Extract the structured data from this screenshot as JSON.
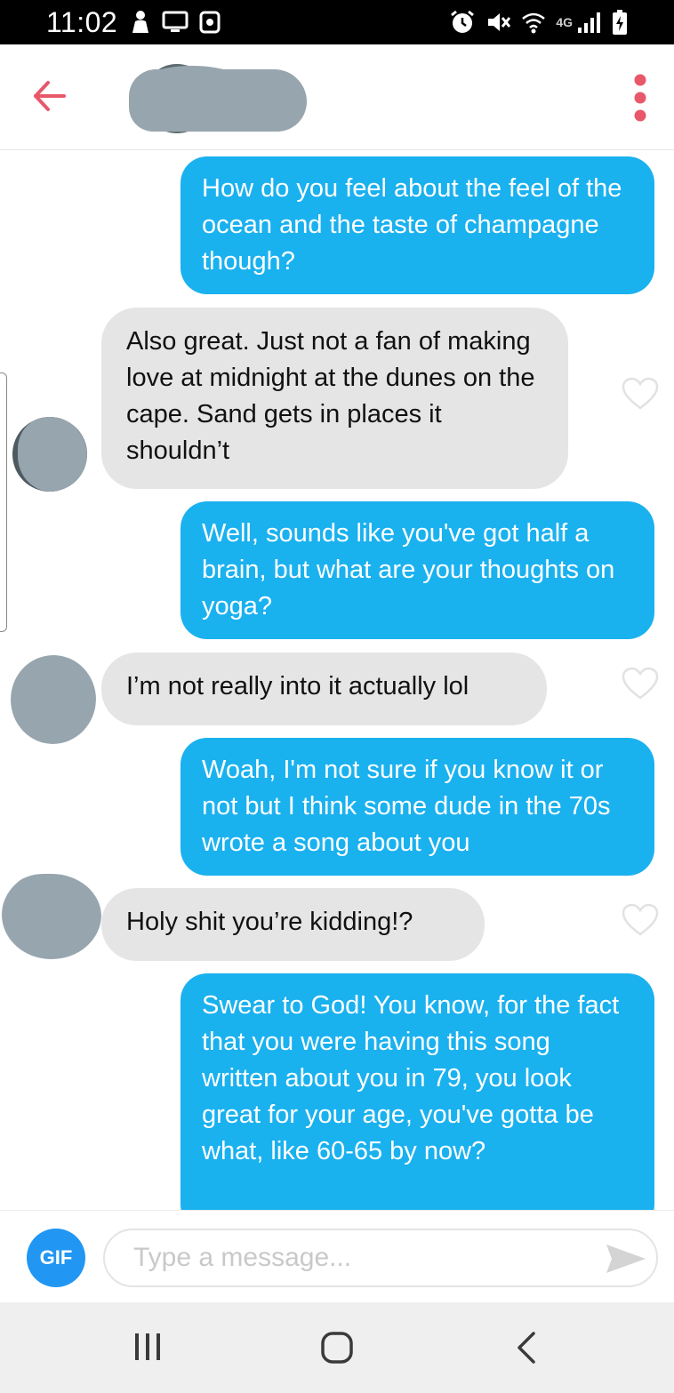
{
  "status_bar": {
    "time": "11:02",
    "network_label": "4G"
  },
  "header": {
    "back_icon": "arrow-left-icon",
    "menu_icon": "vertical-dots-icon",
    "accent_color": "#e8586a"
  },
  "messages": [
    {
      "direction": "outgoing",
      "text": "How do you feel about the feel of the ocean and the taste of champagne though?"
    },
    {
      "direction": "incoming",
      "text": "Also great. Just not a fan of making love at midnight at the dunes on the cape. Sand gets in places it shouldn’t"
    },
    {
      "direction": "outgoing",
      "text": "Well, sounds like you've got half a brain, but what are your thoughts on yoga?"
    },
    {
      "direction": "incoming",
      "text": "I’m not really into it actually lol"
    },
    {
      "direction": "outgoing",
      "text": "Woah, I'm not sure if you know it or not but I think some dude in the 70s wrote a song about you"
    },
    {
      "direction": "incoming",
      "text": "Holy shit you’re kidding!?"
    },
    {
      "direction": "outgoing",
      "text": "Swear to God! You know, for the fact that you were having this song written about you in 79, you look great for your age, you've gotta be what, like 60-65 by now?"
    }
  ],
  "composer": {
    "gif_label": "GIF",
    "placeholder": "Type a message...",
    "send_icon": "send-arrow-icon"
  },
  "colors": {
    "outgoing_bubble": "#1ab1ef",
    "incoming_bubble": "#e5e5e5",
    "gif_button": "#2196f3"
  }
}
